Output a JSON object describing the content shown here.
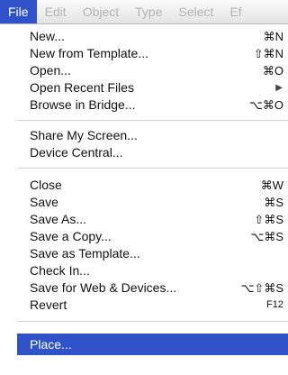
{
  "menubar": {
    "menus": [
      "File",
      "Edit",
      "Object",
      "Type",
      "Select",
      "Ef"
    ]
  },
  "file_menu": {
    "items": [
      {
        "label": "New...",
        "shortcut": "⌘N"
      },
      {
        "label": "New from Template...",
        "shortcut": "⇧⌘N"
      },
      {
        "label": "Open...",
        "shortcut": "⌘O"
      },
      {
        "label": "Open Recent Files",
        "submenu_icon": "▶"
      },
      {
        "label": "Browse in Bridge...",
        "shortcut": "⌥⌘O"
      },
      {
        "label": "Share My Screen..."
      },
      {
        "label": "Device Central..."
      },
      {
        "label": "Close",
        "shortcut": "⌘W"
      },
      {
        "label": "Save",
        "shortcut": "⌘S"
      },
      {
        "label": "Save As...",
        "shortcut": "⇧⌘S"
      },
      {
        "label": "Save a Copy...",
        "shortcut": "⌥⌘S"
      },
      {
        "label": "Save as Template..."
      },
      {
        "label": "Check In..."
      },
      {
        "label": "Save for Web & Devices...",
        "shortcut": "⌥⇧⌘S"
      },
      {
        "label": "Revert",
        "shortcut": "F12"
      },
      {
        "label": "Place...",
        "highlighted": true
      }
    ]
  },
  "colors": {
    "highlight": "#2f52c8",
    "menubar_inactive_text": "#b4b4b4"
  }
}
